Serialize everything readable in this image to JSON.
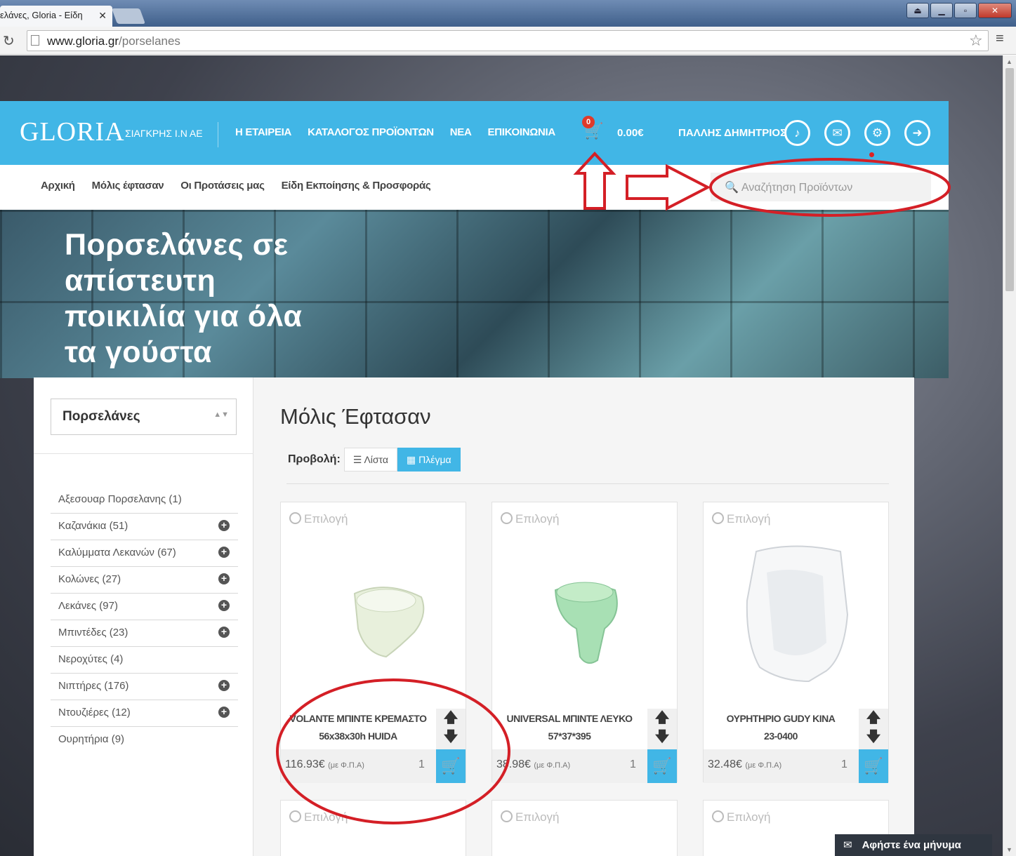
{
  "browser": {
    "tab_title": "ελάνες, Gloria - Είδη",
    "tab_close": "✕",
    "url_host": "www.gloria.gr",
    "url_path": "/porselanes",
    "window_buttons": [
      "⏏",
      "▁",
      "▫",
      "✕"
    ]
  },
  "header": {
    "logo": "GLORIA",
    "company": "ΣΙΑΓΚΡΗΣ Ι.Ν ΑΕ",
    "nav": [
      "Η ΕΤΑΙΡΕΙΑ",
      "ΚΑΤΑΛΟΓΟΣ ΠΡΟΪΟΝΤΩΝ",
      "ΝΕΑ",
      "ΕΠΙΚΟΙΝΩΝΙΑ"
    ],
    "cart_count": "0",
    "cart_total": "0.00€",
    "user_name": "ΠΑΛΛΗΣ ΔΗΜΗΤΡΙΟΣ",
    "icons": [
      "bell-icon",
      "envelope-icon",
      "gear-icon",
      "logout-icon"
    ]
  },
  "subnav": {
    "items": [
      "Αρχική",
      "Μόλις έφτασαν",
      "Οι Προτάσεις μας",
      "Είδη Εκποίησης & Προσφοράς"
    ],
    "search_placeholder": "Αναζήτηση Προϊόντων"
  },
  "hero": {
    "text": "Πορσελάνες σε απίστευτη ποικιλία για όλα τα γούστα"
  },
  "sidebar": {
    "select_value": "Πορσελάνες",
    "categories": [
      {
        "label": "Αξεσουαρ Πορσελανης (1)",
        "expandable": false
      },
      {
        "label": "Καζανάκια (51)",
        "expandable": true
      },
      {
        "label": "Καλύμματα Λεκανών (67)",
        "expandable": true
      },
      {
        "label": "Κολώνες (27)",
        "expandable": true
      },
      {
        "label": "Λεκάνες (97)",
        "expandable": true
      },
      {
        "label": "Μπιντέδες (23)",
        "expandable": true
      },
      {
        "label": "Νεροχύτες (4)",
        "expandable": false
      },
      {
        "label": "Νιπτήρες (176)",
        "expandable": true
      },
      {
        "label": "Ντουζιέρες (12)",
        "expandable": true
      },
      {
        "label": "Ουρητήρια (9)",
        "expandable": false
      }
    ]
  },
  "main": {
    "title": "Μόλις Έφτασαν",
    "view_label": "Προβολή:",
    "view_list": "Λίστα",
    "view_grid": "Πλέγμα",
    "select_label": "Επιλογή",
    "vat_label": "(με Φ.Π.Α)",
    "products": [
      {
        "name_line1": "VOLANTE ΜΠΙΝΤΕ ΚΡΕΜΑΣΤΟ",
        "name_line2": "56x38x30h HUIDA",
        "price": "116.93€",
        "qty": "1"
      },
      {
        "name_line1": "UNIVERSAL ΜΠΙΝΤΕ ΛΕΥΚΟ",
        "name_line2": "57*37*395",
        "price": "38.98€",
        "qty": "1"
      },
      {
        "name_line1": "ΟΥΡΗΤΗΡΙΟ GUDY KINA",
        "name_line2": "23-0400",
        "price": "32.48€",
        "qty": "1"
      }
    ]
  },
  "chat": {
    "label": "Αφήστε ένα μήνυμα"
  },
  "colors": {
    "accent": "#41b6e6",
    "annotation": "#d41f26",
    "header_text": "#ffffff"
  }
}
